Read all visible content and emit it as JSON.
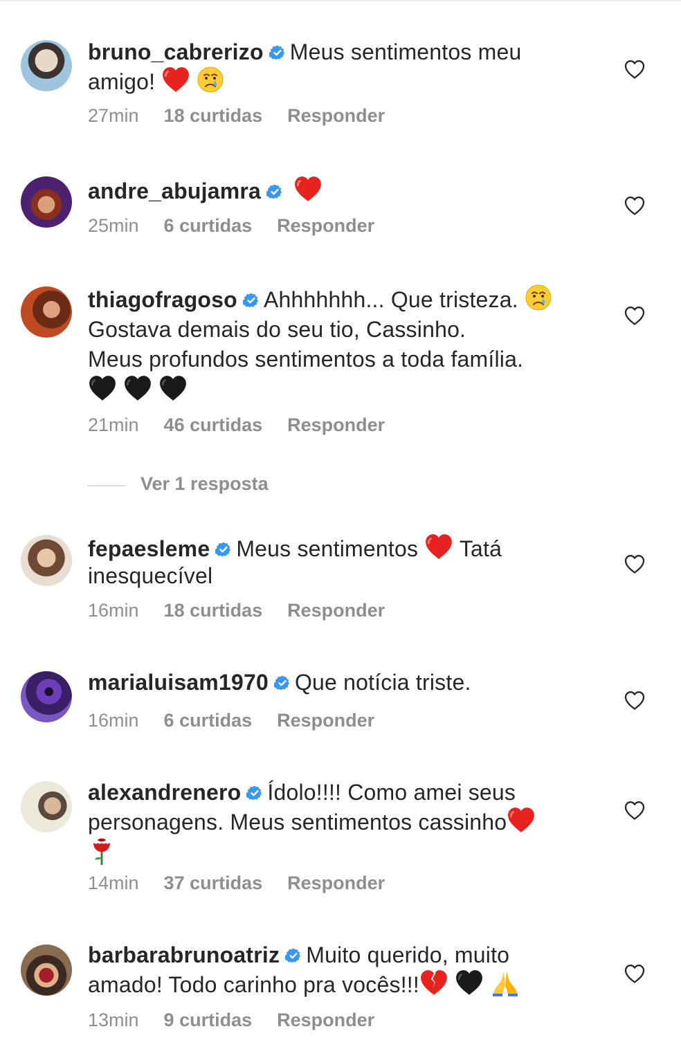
{
  "comments": [
    {
      "username": "bruno_cabrerizo",
      "text": "Meus sentimentos meu",
      "text2": "amigo!",
      "emojis": "❤️ 😢",
      "time": "27min",
      "likes": "18 curtidas",
      "reply": "Responder",
      "avatar_color": "#6b8fa8"
    },
    {
      "username": "andre_abujamra",
      "text": "",
      "emojis": "❤️",
      "time": "25min",
      "likes": "6 curtidas",
      "reply": "Responder",
      "avatar_color": "#5a2a6e"
    },
    {
      "username": "thiagofragoso",
      "text": "Ahhhhhhh... Que tristeza.",
      "line2": "Gostava demais do seu tio, Cassinho.",
      "line3": "Meus profundos sentimentos a toda família.",
      "emojis": "😢",
      "emojis2": "🖤🖤🖤",
      "time": "21min",
      "likes": "46 curtidas",
      "reply": "Responder",
      "view_replies": "Ver 1 resposta",
      "avatar_color": "#8a3a1e"
    },
    {
      "username": "fepaesleme",
      "text": "Meus sentimentos",
      "text_after": "Tatá",
      "line2": "inesquecível",
      "emojis": "❤️",
      "time": "16min",
      "likes": "18 curtidas",
      "reply": "Responder",
      "avatar_color": "#b89478"
    },
    {
      "username": "marialuisam1970",
      "text": "Que notícia triste.",
      "time": "16min",
      "likes": "6 curtidas",
      "reply": "Responder",
      "avatar_color": "#5b2f8c"
    },
    {
      "username": "alexandrenero",
      "text": "Ídolo!!!! Como amei seus",
      "line2": "personagens. Meus sentimentos cassinho",
      "emojis": "❤️",
      "emojis2": "🌹",
      "time": "14min",
      "likes": "37 curtidas",
      "reply": "Responder",
      "avatar_color": "#c9b9a6"
    },
    {
      "username": "barbarabrunoatriz",
      "text": "Muito querido, muito",
      "line2": "amado! Todo carinho pra vocês!!!",
      "emojis": "💔 🖤 🙏",
      "time": "13min",
      "likes": "9 curtidas",
      "reply": "Responder",
      "avatar_color": "#7a4b3a"
    }
  ],
  "colors": {
    "text": "#262626",
    "meta": "#8e8e8e",
    "verified": "#3897f0",
    "heart_red": "#e8231f"
  },
  "icons": {
    "verified": "verified-badge-icon",
    "like": "heart-outline-icon"
  }
}
